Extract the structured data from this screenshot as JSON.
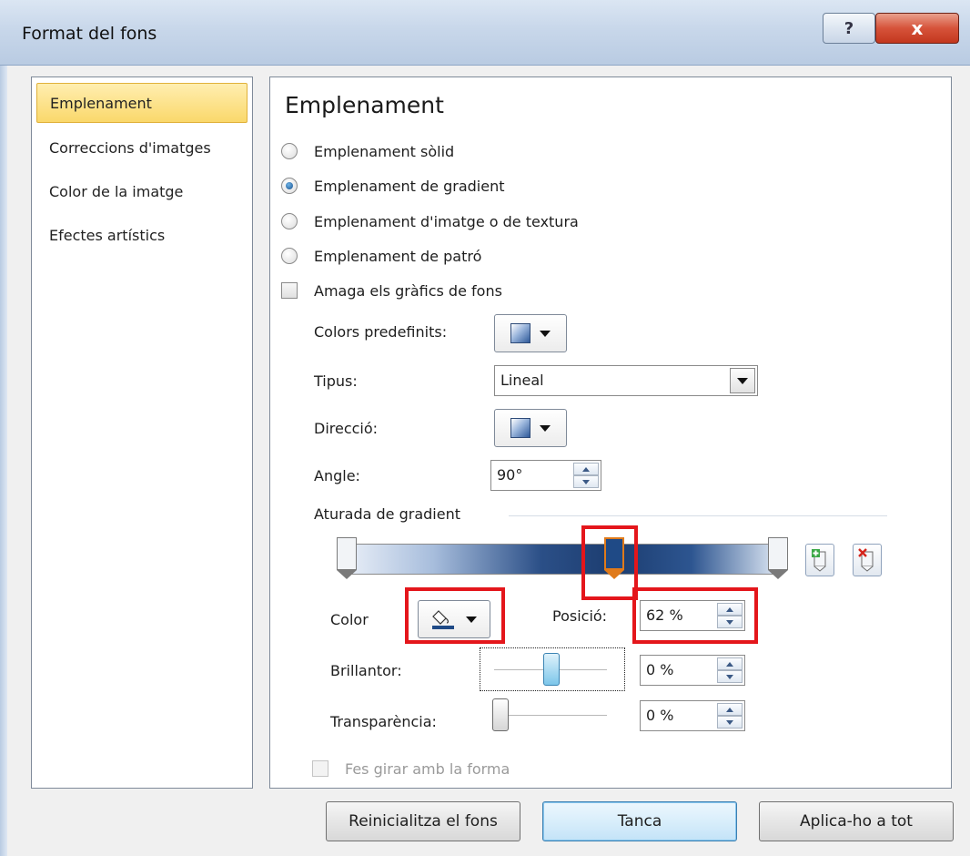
{
  "window": {
    "title": "Format del fons",
    "help_label": "?",
    "close_label": "x"
  },
  "nav": {
    "items": [
      {
        "label": "Emplenament",
        "selected": true
      },
      {
        "label": "Correccions d'imatges",
        "selected": false
      },
      {
        "label": "Color de la imatge",
        "selected": false
      },
      {
        "label": "Efectes artístics",
        "selected": false
      }
    ]
  },
  "main": {
    "section_title": "Emplenament",
    "fill_options": [
      {
        "label": "Emplenament sòlid",
        "checked": false
      },
      {
        "label": "Emplenament de gradient",
        "checked": true
      },
      {
        "label": "Emplenament d'imatge o de textura",
        "checked": false
      },
      {
        "label": "Emplenament de patró",
        "checked": false
      }
    ],
    "hide_graphics": {
      "label": "Amaga els gràfics de fons",
      "checked": false
    },
    "preset_colors_label": "Colors predefinits:",
    "type_label": "Tipus:",
    "type_value": "Lineal",
    "direction_label": "Direcció:",
    "angle_label": "Angle:",
    "angle_value": "90°",
    "gradient_stops_label": "Aturada de gradient",
    "color_label": "Color",
    "position_label": "Posició:",
    "position_value": "62 %",
    "brightness_label": "Brillantor:",
    "brightness_value": "0 %",
    "transparency_label": "Transparència:",
    "transparency_value": "0 %",
    "rotate_with_shape": {
      "label": "Fes girar amb la forma",
      "checked": false,
      "disabled": true
    }
  },
  "footer": {
    "reset_label": "Reinicialitza el fons",
    "close_label": "Tanca",
    "apply_all_label": "Aplica-ho a tot"
  },
  "colors": {
    "highlight": "#e4161b",
    "selected_nav": "#fad86b",
    "gradient_dark": "#1c3d70",
    "active_stop_border": "#e07a1a"
  },
  "gradient_stops": [
    {
      "position": 0,
      "active": false
    },
    {
      "position": 62,
      "active": true
    },
    {
      "position": 100,
      "active": false
    }
  ]
}
